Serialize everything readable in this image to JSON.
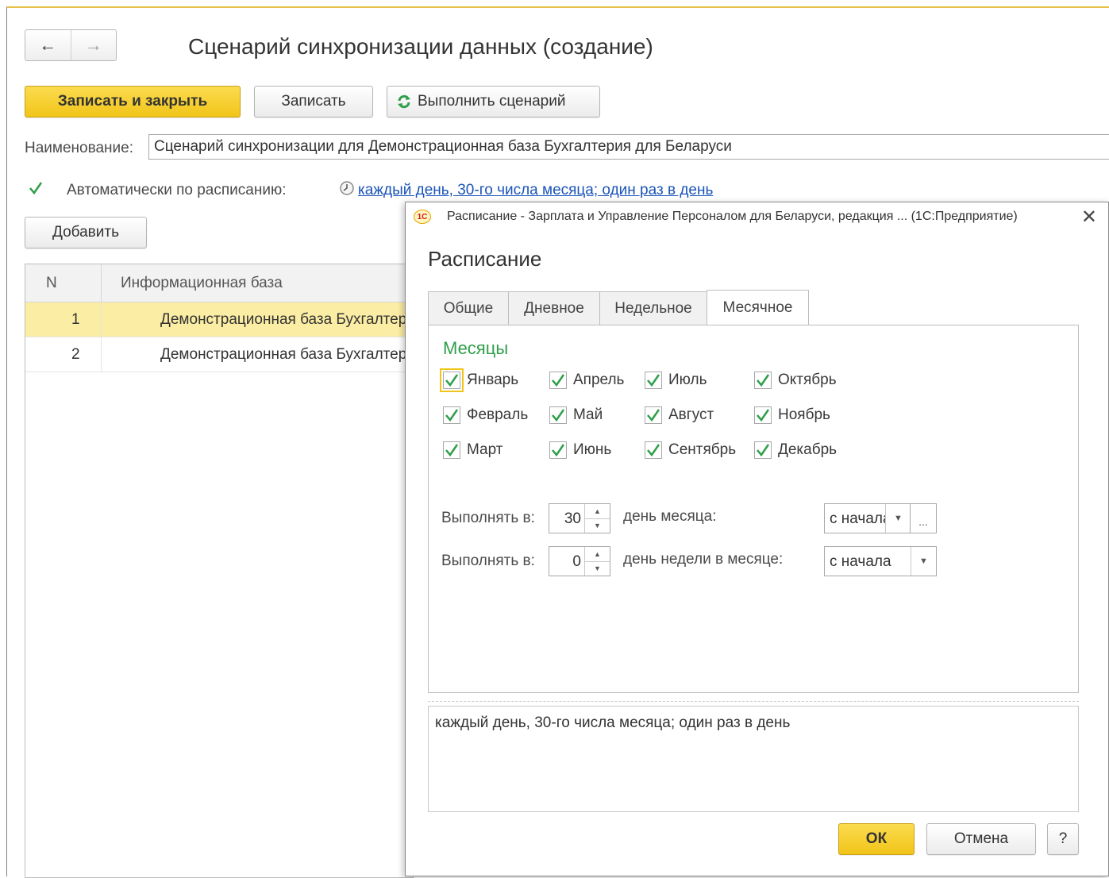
{
  "nav": {
    "back_icon": "←",
    "forward_icon": "→"
  },
  "main": {
    "title": "Сценарий синхронизации данных (создание)",
    "toolbar": {
      "save_close_label": "Записать и закрыть",
      "save_label": "Записать",
      "run_label": "Выполнить сценарий"
    },
    "name_label": "Наименование:",
    "name_value": "Сценарий синхронизации для Демонстрационная база Бухгалтерия для Беларуси",
    "auto_label": "Автоматически по расписанию:",
    "schedule_link": "каждый день, 30-го числа месяца; один раз в день",
    "add_label": "Добавить",
    "table": {
      "columns": [
        "N",
        "Информационная база"
      ],
      "rows": [
        {
          "n": "1",
          "base": "Демонстрационная база Бухгалтерия для Беларуси"
        },
        {
          "n": "2",
          "base": "Демонстрационная база Бухгалтерия для Беларуси"
        }
      ]
    }
  },
  "dialog": {
    "logo": "1С",
    "window_title": "Расписание - Зарплата и Управление Персоналом для Беларуси, редакция ... (1С:Предприятие)",
    "close_icon": "✕",
    "heading": "Расписание",
    "tabs": [
      "Общие",
      "Дневное",
      "Недельное",
      "Месячное"
    ],
    "active_tab": "Месячное",
    "months_title": "Месяцы",
    "months": [
      {
        "label": "Январь",
        "checked": true
      },
      {
        "label": "Февраль",
        "checked": true
      },
      {
        "label": "Март",
        "checked": true
      },
      {
        "label": "Апрель",
        "checked": true
      },
      {
        "label": "Май",
        "checked": true
      },
      {
        "label": "Июнь",
        "checked": true
      },
      {
        "label": "Июль",
        "checked": true
      },
      {
        "label": "Август",
        "checked": true
      },
      {
        "label": "Сентябрь",
        "checked": true
      },
      {
        "label": "Октябрь",
        "checked": true
      },
      {
        "label": "Ноябрь",
        "checked": true
      },
      {
        "label": "Декабрь",
        "checked": true
      }
    ],
    "run_at_label": "Выполнять в:",
    "day_of_month_value": "30",
    "day_of_month_label": "день месяца:",
    "day_of_month_from": "с начала",
    "day_of_week_value": "0",
    "day_of_week_label": "день недели в месяце:",
    "day_of_week_from": "с начала",
    "description": "каждый день, 30-го числа месяца; один раз в день",
    "ok_label": "ОК",
    "cancel_label": "Отмена",
    "help_label": "?"
  },
  "colors": {
    "accent_yellow": "#f1c419",
    "link": "#1a54b8",
    "green": "#2e9f4a",
    "selected_row": "#fbeda3"
  }
}
